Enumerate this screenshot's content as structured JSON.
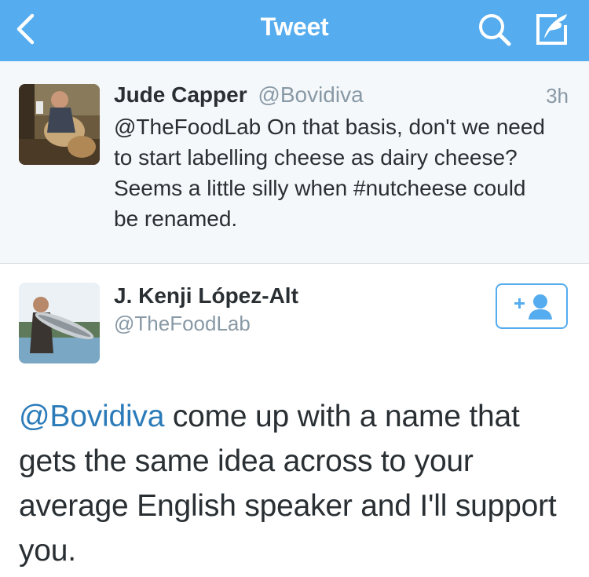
{
  "navbar": {
    "title": "Tweet",
    "background_color": "#55acee",
    "icons": [
      "chevron-left-icon",
      "search-icon",
      "compose-icon"
    ]
  },
  "reply_tweet": {
    "author_name": "Jude Capper",
    "author_handle": "@Bovidiva",
    "time": "3h",
    "text": "@TheFoodLab On that basis, don't we need to start labelling cheese as dairy cheese? Seems a little silly when #nutcheese could be renamed."
  },
  "main_tweet": {
    "author_name": "J. Kenji López-Alt",
    "author_handle": "@TheFoodLab",
    "follow_icon": "add-user-icon",
    "mention": "@Bovidiva",
    "text_rest": " come up with a name that gets the same idea across to your average English speaker and I'll support you."
  },
  "colors": {
    "accent": "#55acee",
    "link": "#2b7bb9",
    "text": "#292f33",
    "muted": "#8899a6",
    "reply_background": "#f5f8fa"
  }
}
